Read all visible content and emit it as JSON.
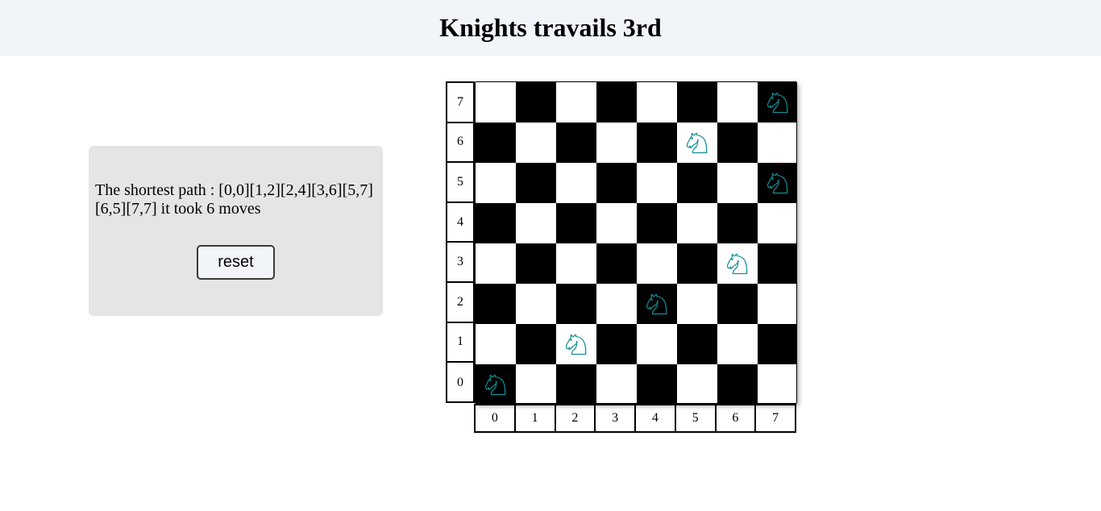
{
  "header": {
    "title": "Knights travails 3rd"
  },
  "info": {
    "path_text": "The shortest path : [0,0][1,2][2,4][3,6][5,7][6,5][7,7] it took 6 moves",
    "reset_label": "reset"
  },
  "board": {
    "size": 8,
    "rank_labels": [
      "7",
      "6",
      "5",
      "4",
      "3",
      "2",
      "1",
      "0"
    ],
    "file_labels": [
      "0",
      "1",
      "2",
      "3",
      "4",
      "5",
      "6",
      "7"
    ],
    "light_color": "#ffffff",
    "dark_color": "#000000",
    "knight_color": "#0e8f96",
    "knight_positions": [
      [
        0,
        0
      ],
      [
        2,
        1
      ],
      [
        4,
        2
      ],
      [
        6,
        3
      ],
      [
        7,
        5
      ],
      [
        5,
        6
      ],
      [
        7,
        7
      ]
    ]
  }
}
